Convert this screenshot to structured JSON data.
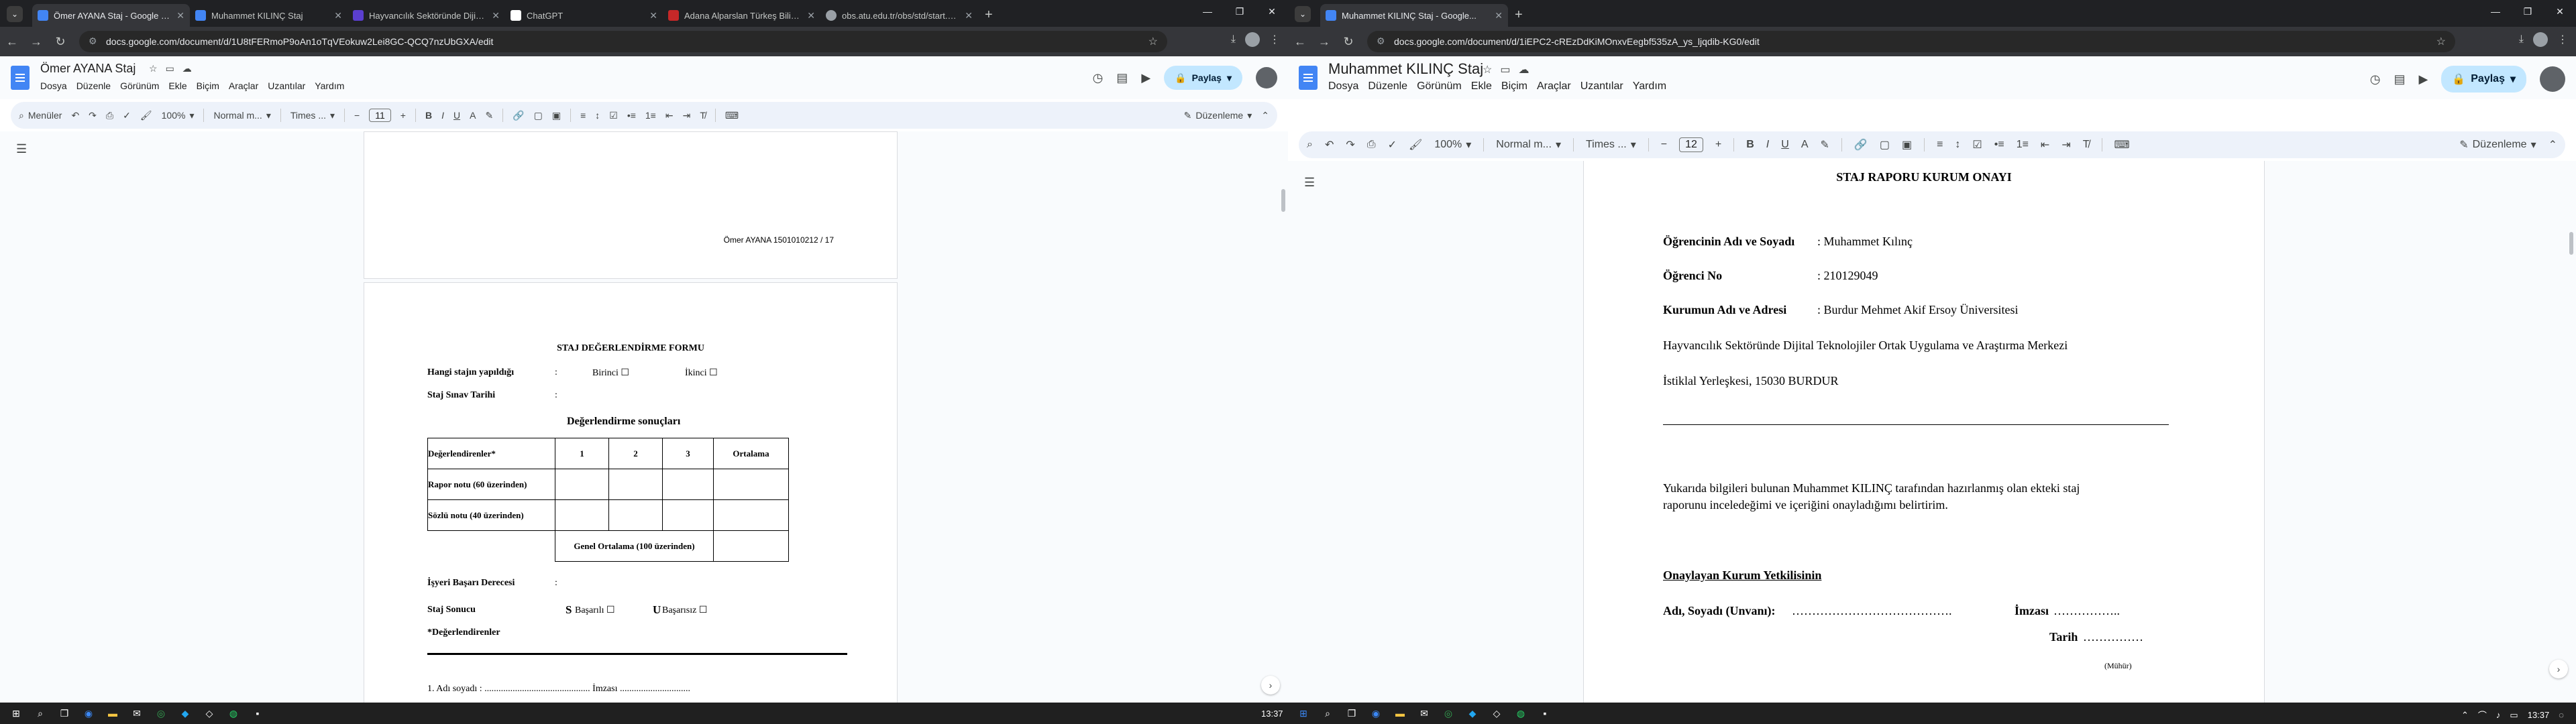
{
  "left_window": {
    "tabs": [
      {
        "title": "Ömer AYANA Staj - Google Doki...",
        "active": true,
        "color": "#4285f4"
      },
      {
        "title": "Muhammet KILINÇ Staj",
        "active": false,
        "color": "#4285f4"
      },
      {
        "title": "Hayvancılık Sektöründe Dijital T...",
        "active": false,
        "color": "#5b3fd0"
      },
      {
        "title": "ChatGPT",
        "active": false,
        "color": "#ffffff"
      },
      {
        "title": "Adana Alparslan Türkeş Bilim ve...",
        "active": false,
        "color": "#c62828"
      },
      {
        "title": "obs.atu.edu.tr/obs/std/start.as...",
        "active": false,
        "color": "#9aa0a6"
      }
    ],
    "url": "docs.google.com/document/d/1U8tFERmoP9oAn1oTqVEokuw2Lei8GC-QCQ7nzUbGXA/edit",
    "doc_title": "Ömer AYANA Staj",
    "menus": [
      "Dosya",
      "Düzenle",
      "Görünüm",
      "Ekle",
      "Biçim",
      "Araçlar",
      "Uzantılar",
      "Yardım"
    ],
    "share_label": "Paylaş",
    "toolbar": {
      "menus_label": "Menüler",
      "zoom": "100%",
      "style": "Normal m...",
      "font": "Times ...",
      "size": "11",
      "mode": "Düzenleme"
    },
    "page1_footer": "Ömer AYANA 1501010212 / 17",
    "form": {
      "title": "STAJ DEĞERLENDİRME FORMU",
      "row1_label": "Hangi stajın yapıldığı",
      "colon": ":",
      "opt1": "Birinci ☐",
      "opt2": "İkinci ☐",
      "row2_label": "Staj Sınav Tarihi",
      "results_title": "Değerlendirme sonuçları",
      "table_headers": [
        "Değerlendirenler*",
        "1",
        "2",
        "3",
        "Ortalama"
      ],
      "table_rows": [
        "Rapor notu (60 üzerinden)",
        "Sözlü notu (40 üzerinden)"
      ],
      "total_label": "Genel Ortalama (100 üzerinden)",
      "workplace_label": "İşyeri Başarı Derecesi",
      "result_label": "Staj Sonucu",
      "success_letter": "S",
      "success_word": "Başarılı ☐",
      "fail_letter": "U",
      "fail_word": "Başarısız ☐",
      "evaluators": "*Değerlendirenler",
      "line1": "1. Adı soyadı   : .............................................   İmzası .............................."
    }
  },
  "right_window": {
    "tabs": [
      {
        "title": "Muhammet KILINÇ Staj - Google...",
        "active": true,
        "color": "#4285f4"
      }
    ],
    "url": "docs.google.com/document/d/1iEPC2-cREzDdKiMOnxvEegbf535zA_ys_ljqdib-KG0/edit",
    "doc_title": "Muhammet KILINÇ Staj",
    "menus": [
      "Dosya",
      "Düzenle",
      "Görünüm",
      "Ekle",
      "Biçim",
      "Araçlar",
      "Uzantılar",
      "Yardım"
    ],
    "share_label": "Paylaş",
    "toolbar": {
      "zoom": "100%",
      "style": "Normal m...",
      "font": "Times ...",
      "size": "12",
      "mode": "Düzenleme"
    },
    "doc": {
      "heading": "STAJ RAPORU KURUM ONAYI",
      "name_label": "Öğrencinin Adı ve Soyadı",
      "name_value": ":  Muhammet Kılınç",
      "no_label": "Öğrenci No",
      "no_value": ":  210129049",
      "inst_label": "Kurumun Adı ve Adresi",
      "inst_value": ":  Burdur Mehmet Akif Ersoy Üniversitesi",
      "center": "Hayvancılık Sektöründe Dijital Teknolojiler Ortak Uygulama ve Araştırma Merkezi",
      "address": "İstiklal Yerleşkesi, 15030 BURDUR",
      "approval_line1": "Yukarıda  bilgileri  bulunan  Muhammet  KILINÇ  tarafından  hazırlanmış  olan  ekteki  staj",
      "approval_line2": "raporunu inceledeğimi ve içeriğini onayladığımı belirtirim.",
      "authority": "Onaylayan Kurum Yetkilisinin",
      "name_title": "Adı, Soyadı (Unvanı):",
      "name_dots": " ………………………………….",
      "signature": "İmzası",
      "sig_dots": "……………..",
      "date": "Tarih",
      "date_dots": " ……………",
      "seal": "(Mühür)"
    }
  },
  "taskbar": {
    "time_left": "13:37",
    "time_right": "13:37"
  }
}
